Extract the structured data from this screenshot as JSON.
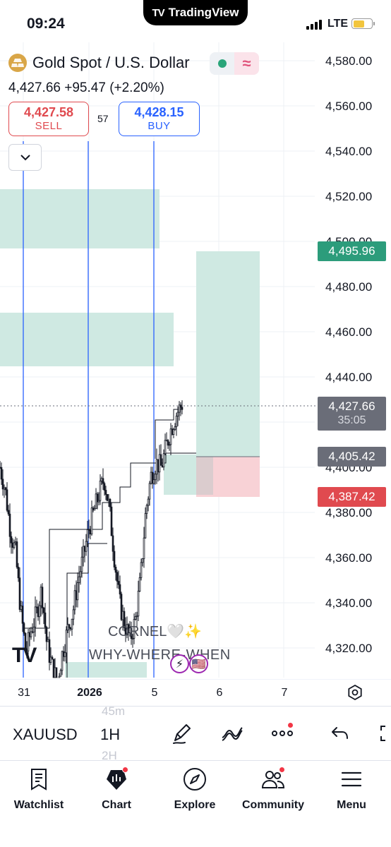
{
  "status_bar": {
    "time": "09:24",
    "brand": "TradingView",
    "network": "LTE"
  },
  "symbol": {
    "title": "Gold Spot / U.S. Dollar",
    "last": "4,427.66",
    "change": "+95.47",
    "change_pct": "(+2.20%)",
    "sell_price": "4,427.58",
    "sell_label": "SELL",
    "buy_price": "4,428.15",
    "buy_label": "BUY",
    "spread": "57"
  },
  "price_axis": [
    "4,580.00",
    "4,560.00",
    "4,540.00",
    "4,520.00",
    "4,500.00",
    "4,480.00",
    "4,460.00",
    "4,440.00",
    "4,400.00",
    "4,380.00",
    "4,360.00",
    "4,340.00",
    "4,320.00"
  ],
  "price_tags": {
    "target": "4,495.96",
    "current": "4,427.66",
    "countdown": "35:05",
    "entry": "4,405.42",
    "stop": "4,387.42"
  },
  "time_axis": [
    "31",
    "2026",
    "5",
    "6",
    "7"
  ],
  "watermark": {
    "line1": "CORNEL🤍✨",
    "line2": "WHY-WHERE-WHEN"
  },
  "toolbar": {
    "symbol": "XAUUSD",
    "interval": "1H",
    "interval_above": "45m",
    "interval_below": "2H"
  },
  "nav": [
    "Watchlist",
    "Chart",
    "Explore",
    "Community",
    "Menu"
  ],
  "colors": {
    "bull_zone": "#cfe9e2",
    "bear_zone": "#f8d2d6",
    "blue_line": "#2962ff",
    "sell": "#e04a4f",
    "buy": "#2962ff",
    "target_tag": "#2c9c7b",
    "neutral_tag": "#6a6d78"
  },
  "chart_data": {
    "type": "candlestick",
    "symbol": "XAUUSD",
    "interval": "1H",
    "y_ticks": [
      4580,
      4560,
      4540,
      4520,
      4500,
      4480,
      4460,
      4440,
      4400,
      4380,
      4360,
      4340,
      4320
    ],
    "x_ticks": [
      "31",
      "2026",
      "5",
      "6",
      "7"
    ],
    "last_price": 4427.66,
    "position": {
      "target": 4495.96,
      "entry": 4405.42,
      "stop": 4387.42
    },
    "demand_zones": [
      {
        "from": 4496,
        "to": 4522
      },
      {
        "from": 4444,
        "to": 4468
      },
      {
        "from": 4388,
        "to": 4406
      }
    ],
    "approx_path": [
      4400,
      4390,
      4372,
      4362,
      4336,
      4318,
      4328,
      4335,
      4346,
      4322,
      4312,
      4305,
      4318,
      4328,
      4336,
      4350,
      4360,
      4372,
      4380,
      4388,
      4395,
      4382,
      4360,
      4340,
      4330,
      4324,
      4332,
      4350,
      4380,
      4396,
      4402,
      4400,
      4410,
      4418,
      4424,
      4428
    ]
  }
}
